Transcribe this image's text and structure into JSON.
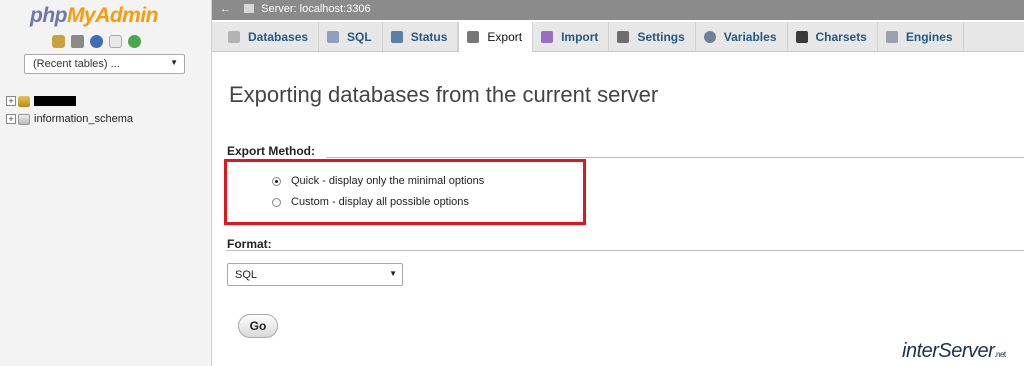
{
  "sidebar": {
    "logo_php": "php",
    "logo_myadmin": "MyAdmin",
    "recent_tables": "(Recent tables) ...",
    "tree": [
      {
        "label": ""
      },
      {
        "label": "information_schema"
      }
    ]
  },
  "breadcrumb": {
    "server": "Server: localhost:3306"
  },
  "tabs": [
    {
      "label": "Databases"
    },
    {
      "label": "SQL"
    },
    {
      "label": "Status"
    },
    {
      "label": "Export"
    },
    {
      "label": "Import"
    },
    {
      "label": "Settings"
    },
    {
      "label": "Variables"
    },
    {
      "label": "Charsets"
    },
    {
      "label": "Engines"
    }
  ],
  "main": {
    "heading": "Exporting databases from the current server",
    "export_method_label": "Export Method:",
    "options": [
      {
        "label": "Quick - display only the minimal options",
        "checked": true
      },
      {
        "label": "Custom - display all possible options",
        "checked": false
      }
    ],
    "format_label": "Format:",
    "format_value": "SQL",
    "go_label": "Go"
  },
  "watermark": {
    "text": "interServer",
    "suffix": ".net"
  },
  "colors": {
    "highlight": "#e0161c",
    "tab_link": "#235a81",
    "logo_php": "#6c78af",
    "logo_myadmin": "#f89c0e"
  }
}
